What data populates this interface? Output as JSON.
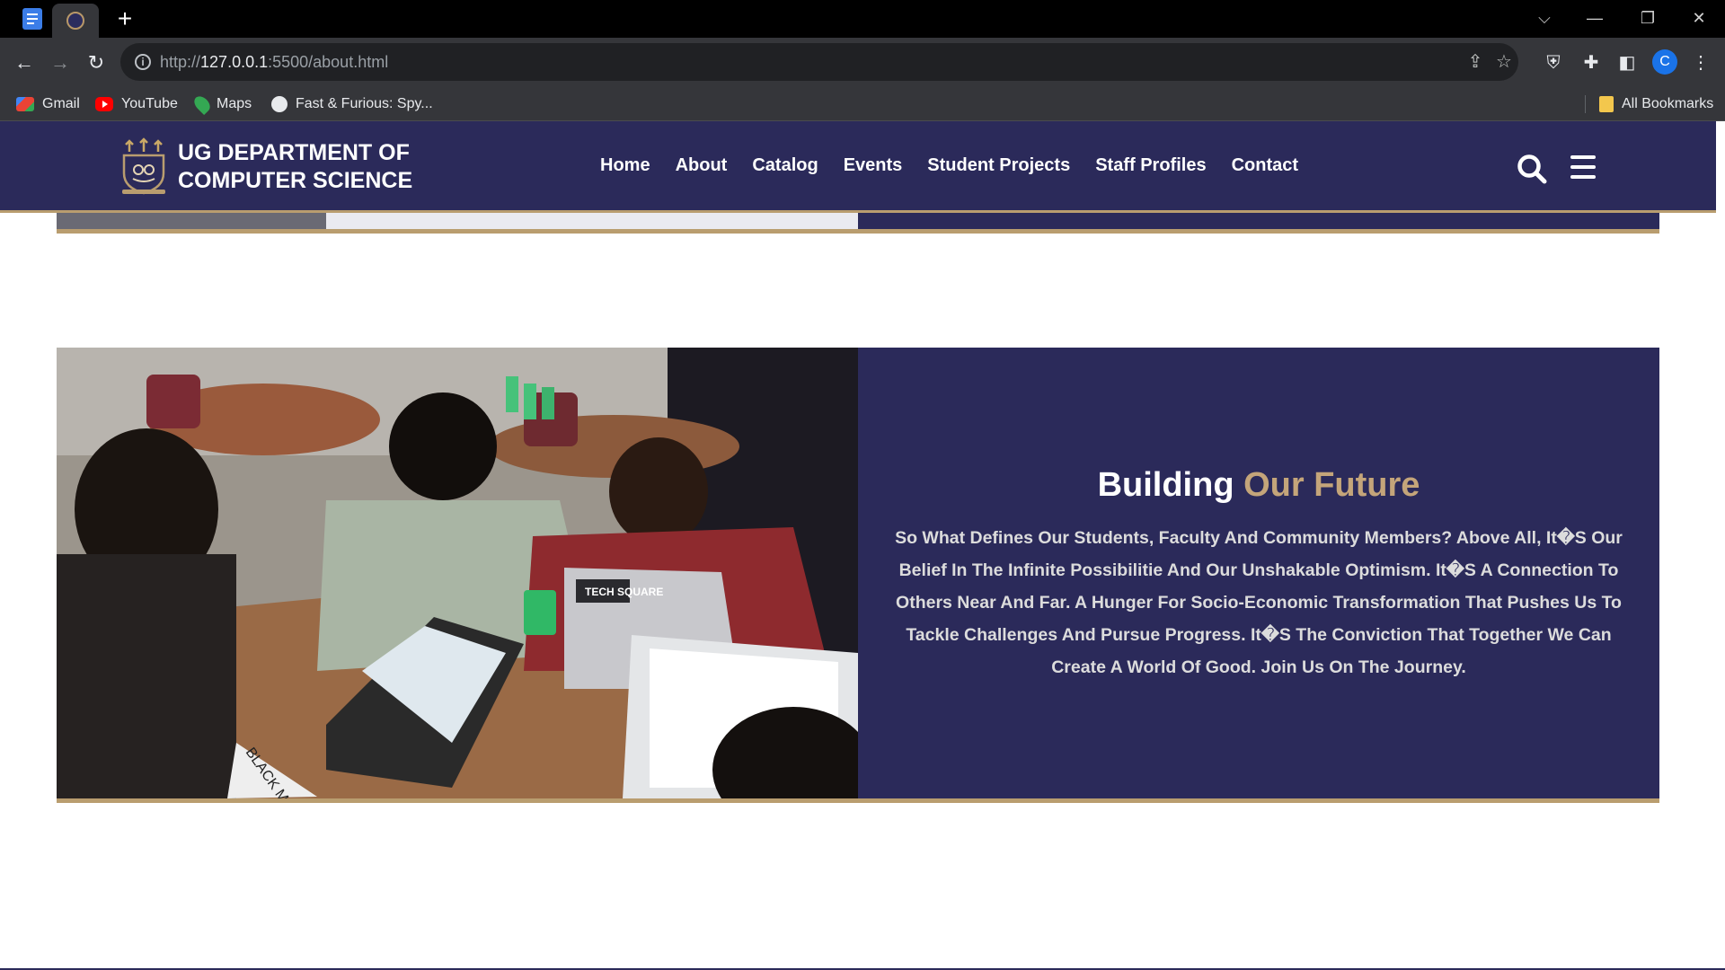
{
  "browser": {
    "url_scheme": "http://",
    "url_host": "127.0.0.1",
    "url_rest": ":5500/about.html",
    "bookmarks": [
      {
        "label": "Gmail",
        "icon": "gmail-icon"
      },
      {
        "label": "YouTube",
        "icon": "youtube-icon"
      },
      {
        "label": "Maps",
        "icon": "maps-icon"
      },
      {
        "label": "Fast & Furious: Spy...",
        "icon": "globe-icon"
      }
    ],
    "all_bookmarks": "All Bookmarks",
    "profile_initial": "C"
  },
  "site": {
    "brand_line1": "UG DEPARTMENT OF",
    "brand_line2": "COMPUTER SCIENCE",
    "nav": [
      "Home",
      "About",
      "Catalog",
      "Events",
      "Student Projects",
      "Staff Profiles",
      "Contact"
    ]
  },
  "feature": {
    "title_plain": "Building ",
    "title_accent": "Our Future",
    "body": "So What Defines Our Students, Faculty And Community Members? Above All, It�S Our Belief In The Infinite Possibilitie And Our Unshakable Optimism. It�S A Connection To Others Near And Far. A Hunger For Socio-Economic Transformation That Pushes Us To Tackle Challenges And Pursue Progress. It�S The Conviction That Together We Can Create A World Of Good. Join Us On The Journey.",
    "photo_laptop_sticker": "TECH SQUARE",
    "photo_card_text": "BLACK ME"
  },
  "colors": {
    "navy": "#2b2a5a",
    "gold": "#b99d6f",
    "accent_text": "#c4a57a"
  }
}
